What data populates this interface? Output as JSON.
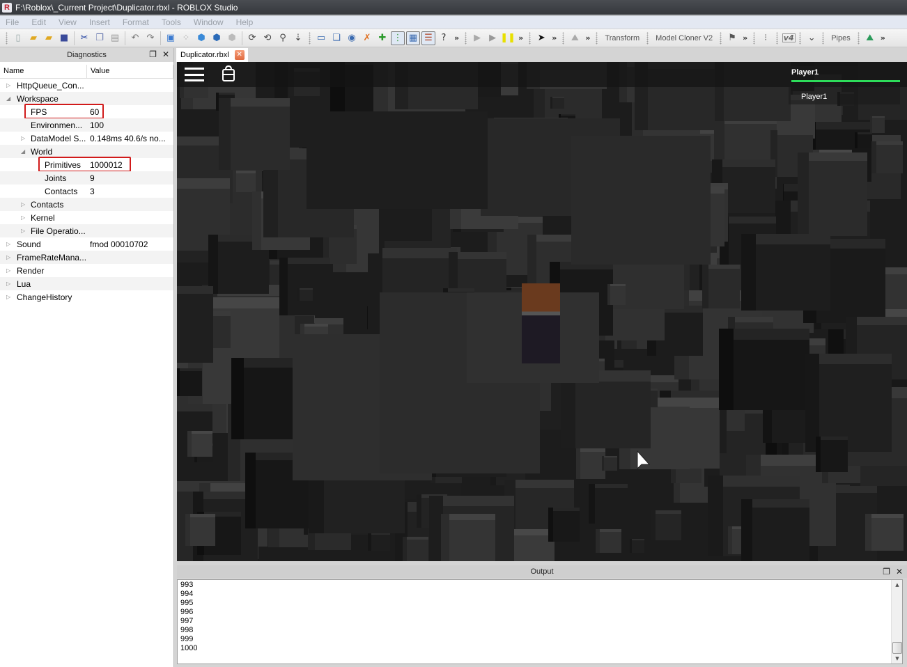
{
  "window": {
    "title": "F:\\Roblox\\_Current Project\\Duplicator.rbxl - ROBLOX Studio",
    "app_icon_letter": "R"
  },
  "menu": [
    "File",
    "Edit",
    "View",
    "Insert",
    "Format",
    "Tools",
    "Window",
    "Help"
  ],
  "toolbar": {
    "more_label": "»",
    "transform_label": "Transform",
    "model_cloner_label": "Model Cloner V2",
    "v4_label": "v4",
    "pipes_label": "Pipes"
  },
  "diagnostics": {
    "title": "Diagnostics",
    "columns": {
      "name": "Name",
      "value": "Value"
    },
    "rows": [
      {
        "name": "HttpQueue_Con...",
        "value": "",
        "level": 0,
        "expander": "collapsed"
      },
      {
        "name": "Workspace",
        "value": "",
        "level": 0,
        "expander": "expanded"
      },
      {
        "name": "FPS",
        "value": "60",
        "level": 1,
        "expander": "none",
        "highlighted": true
      },
      {
        "name": "Environmen...",
        "value": "100",
        "level": 1,
        "expander": "none"
      },
      {
        "name": "DataModel S...",
        "value": "0.148ms 40.6/s no...",
        "level": 1,
        "expander": "collapsed"
      },
      {
        "name": "World",
        "value": "",
        "level": 1,
        "expander": "expanded"
      },
      {
        "name": "Primitives",
        "value": "1000012",
        "level": 2,
        "expander": "none",
        "highlighted": true
      },
      {
        "name": "Joints",
        "value": "9",
        "level": 2,
        "expander": "none"
      },
      {
        "name": "Contacts",
        "value": "3",
        "level": 2,
        "expander": "none"
      },
      {
        "name": "Contacts",
        "value": "",
        "level": 1,
        "expander": "collapsed"
      },
      {
        "name": "Kernel",
        "value": "",
        "level": 1,
        "expander": "collapsed"
      },
      {
        "name": "File Operatio...",
        "value": "",
        "level": 1,
        "expander": "collapsed"
      },
      {
        "name": "Sound",
        "value": "fmod 00010702",
        "level": 0,
        "expander": "collapsed"
      },
      {
        "name": "FrameRateMana...",
        "value": "",
        "level": 0,
        "expander": "collapsed"
      },
      {
        "name": "Render",
        "value": "",
        "level": 0,
        "expander": "collapsed"
      },
      {
        "name": "Lua",
        "value": "",
        "level": 0,
        "expander": "collapsed"
      },
      {
        "name": "ChangeHistory",
        "value": "",
        "level": 0,
        "expander": "collapsed"
      }
    ]
  },
  "document_tab": {
    "label": "Duplicator.rbxl",
    "close_glyph": "✕"
  },
  "viewport": {
    "player_list": {
      "header": "Player1",
      "entries": [
        "Player1"
      ],
      "accent_color": "#2ddc5a"
    }
  },
  "output": {
    "title": "Output",
    "lines": [
      "993",
      "994",
      "995",
      "996",
      "997",
      "998",
      "999",
      "1000"
    ]
  },
  "colors": {
    "highlight_box": "#d11a1a"
  }
}
